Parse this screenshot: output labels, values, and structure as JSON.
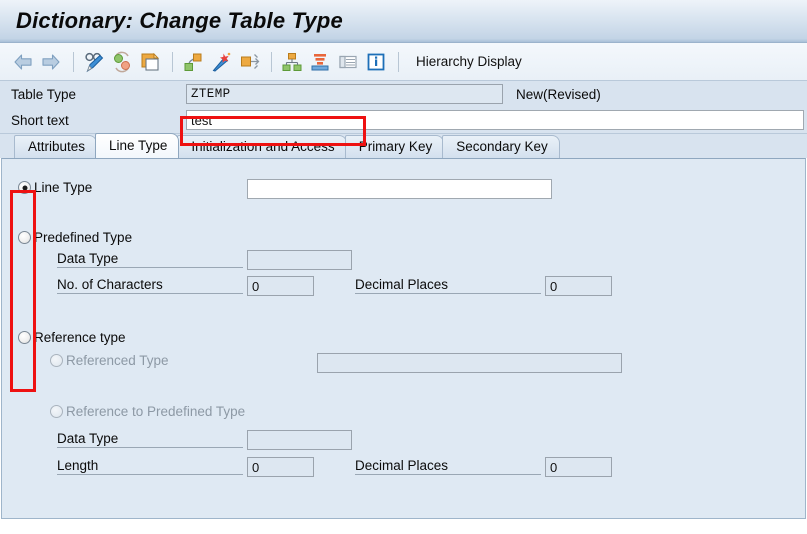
{
  "window": {
    "title": "Dictionary: Change Table Type"
  },
  "toolbar": {
    "label": "Hierarchy Display",
    "items": [
      {
        "name": "back-icon",
        "tooltip": "Back"
      },
      {
        "name": "forward-icon",
        "tooltip": "Forward"
      },
      {
        "name": "display-change-icon",
        "tooltip": "Display/Change"
      },
      {
        "name": "replace-icon",
        "tooltip": "Replace"
      },
      {
        "name": "copy-icon",
        "tooltip": "Copy"
      },
      {
        "name": "where-used-icon",
        "tooltip": "Where-Used List"
      },
      {
        "name": "wand-icon",
        "tooltip": "Generate"
      },
      {
        "name": "expand-icon",
        "tooltip": "Expand"
      },
      {
        "name": "hierarchy-icon",
        "tooltip": "Hierarchy"
      },
      {
        "name": "stack-icon",
        "tooltip": "Stack"
      },
      {
        "name": "table-icon",
        "tooltip": "Table"
      },
      {
        "name": "info-icon",
        "tooltip": "Information"
      }
    ]
  },
  "header": {
    "table_type_label": "Table Type",
    "table_type_value": "ZTEMP",
    "status": "New(Revised)",
    "short_text_label": "Short text",
    "short_text_value": "test"
  },
  "tabs": [
    {
      "label": "Attributes",
      "active": false
    },
    {
      "label": "Line Type",
      "active": true
    },
    {
      "label": "Initialization and Access",
      "active": false
    },
    {
      "label": "Primary Key",
      "active": false
    },
    {
      "label": "Secondary Key",
      "active": false
    }
  ],
  "form": {
    "line_type": {
      "label": "Line Type",
      "selected": true,
      "value": ""
    },
    "predefined_type": {
      "label": "Predefined Type",
      "selected": false,
      "data_type_label": "Data Type",
      "data_type_value": "",
      "no_of_characters_label": "No. of Characters",
      "no_of_characters_value": "0",
      "decimal_places_label": "Decimal Places",
      "decimal_places_value": "0"
    },
    "reference_type": {
      "label": "Reference type",
      "selected": false,
      "referenced_type_label": "Referenced Type",
      "referenced_type_value": "",
      "reference_to_predefined_label": "Reference to Predefined Type",
      "data_type_label": "Data Type",
      "data_type_value": "",
      "length_label": "Length",
      "length_value": "0",
      "decimal_places_label": "Decimal Places",
      "decimal_places_value": "0"
    }
  },
  "annotations": {
    "short_text_highlight": "red-box-short-text",
    "radio_group_highlight": "red-box-radio-group"
  },
  "colors": {
    "annotation": "#ee1111",
    "panel_bg": "#dfe9f3",
    "header_bg": "#d8e3ef",
    "title_accent": "#a9c0d8"
  }
}
